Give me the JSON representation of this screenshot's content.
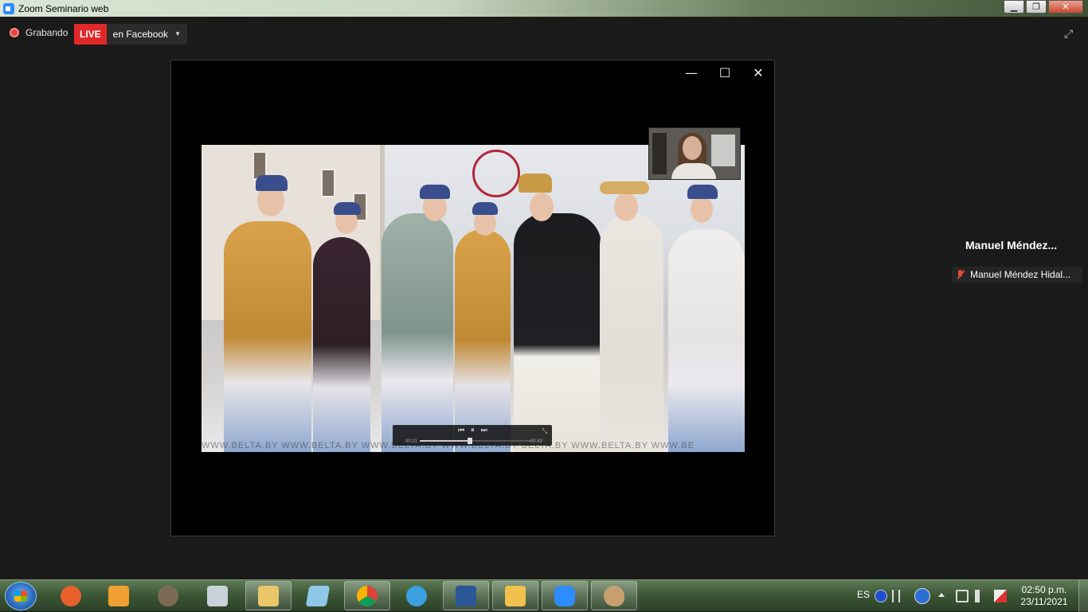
{
  "window": {
    "title": "Zoom Seminario web",
    "controls": {
      "minimize": "▁",
      "maximize": "❐",
      "close": "✕"
    }
  },
  "header": {
    "recording_label": "Grabando",
    "live_badge": "LIVE",
    "live_target": "en Facebook",
    "caret": "▼",
    "fullscreen_icon": "⤢"
  },
  "share": {
    "controls": {
      "minimize": "—",
      "maximize": "☐",
      "close": "✕"
    },
    "watermark": "WWW.BELTA.BY    WWW.BELTA.BY    WWW.BELTA.BY    WWW.BELTA.BY    BELTA.BY    WWW.BELTA.BY    WWW.BE",
    "player": {
      "time_elapsed": "00:21",
      "time_remaining": "-00:43",
      "progress": 0.45,
      "btn_prev": "⏮",
      "btn_pause": "⏸",
      "btn_next": "⏭",
      "btn_expand": "⤡"
    }
  },
  "panel": {
    "name_short": "Manuel  Méndez...",
    "name_full": "Manuel Méndez Hidal..."
  },
  "taskbar": {
    "language": "ES",
    "time": "02:50 p.m.",
    "date": "23/11/2021",
    "colors": {
      "firefox": "#e8602c",
      "media": "#f0a030",
      "gimp": "#7d6a55",
      "calculator": "#c9d2d8",
      "explorer": "#e9c66a",
      "notepad": "#8fc7e6",
      "chrome": "#db4437",
      "ie": "#3aa0e0",
      "word": "#2b5797",
      "outlook": "#f2c14d",
      "zoom": "#2d8cff",
      "paint": "#c8a070"
    }
  }
}
